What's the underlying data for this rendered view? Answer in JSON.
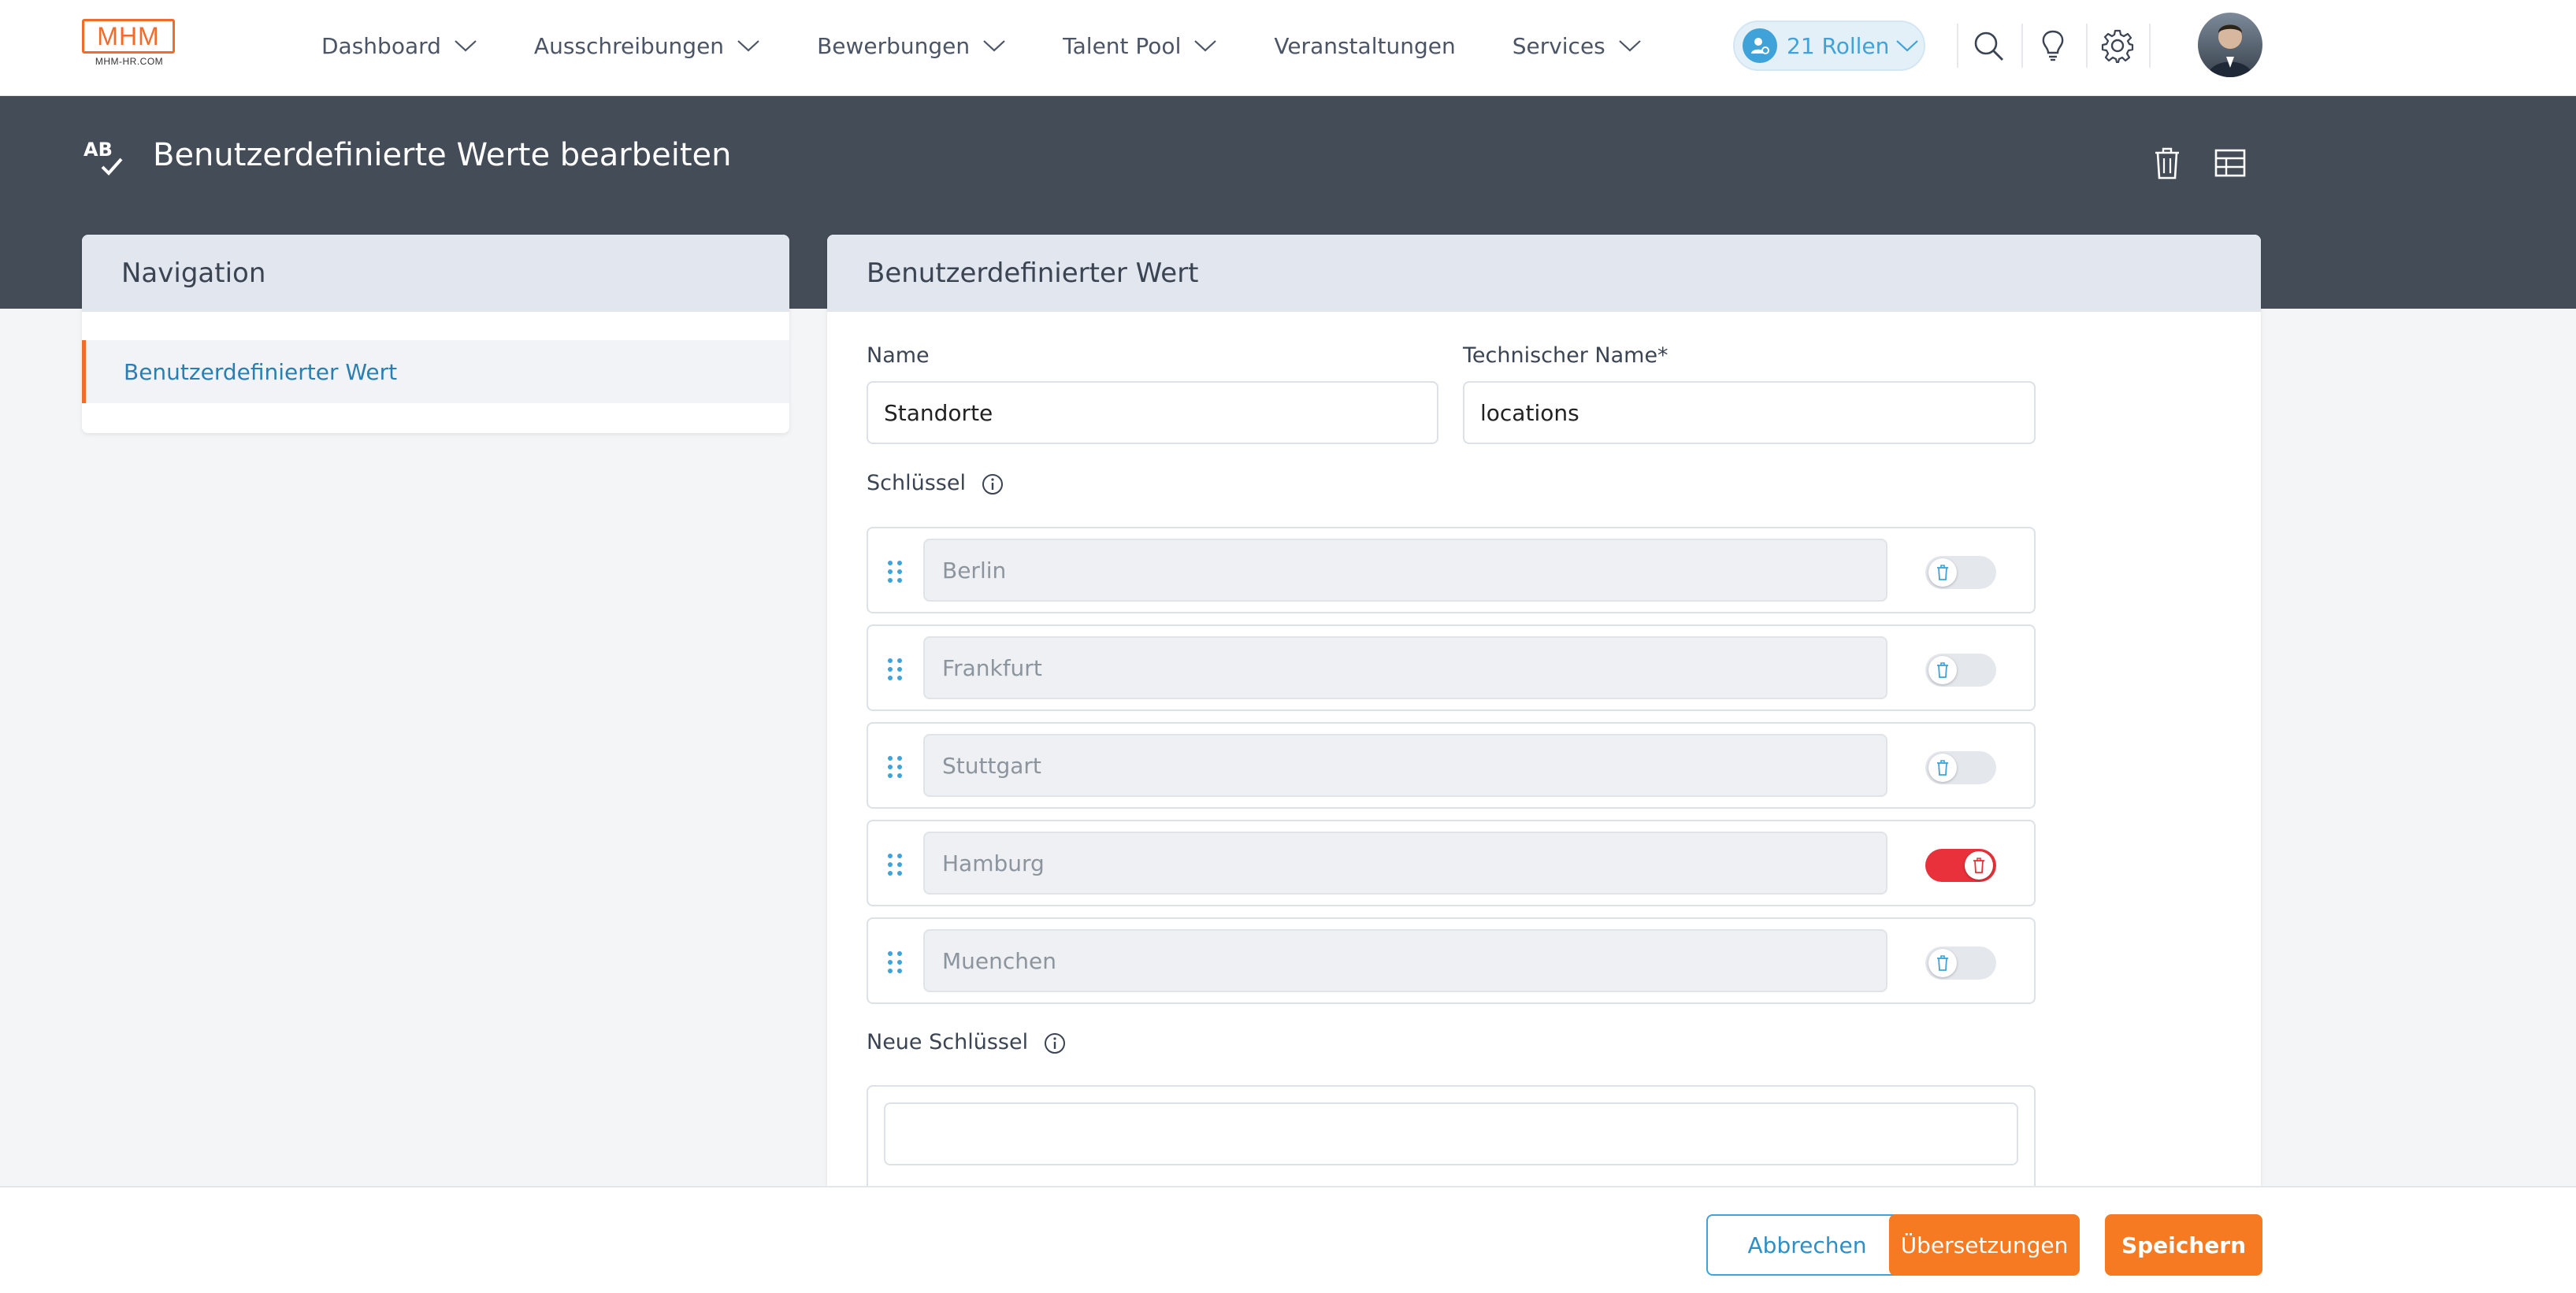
{
  "logo": {
    "brand": "MHM",
    "sub": "MHM-HR.COM"
  },
  "nav": {
    "items": [
      {
        "label": "Dashboard",
        "has_menu": true
      },
      {
        "label": "Ausschreibungen",
        "has_menu": true
      },
      {
        "label": "Bewerbungen",
        "has_menu": true
      },
      {
        "label": "Talent Pool",
        "has_menu": true
      },
      {
        "label": "Veranstaltungen",
        "has_menu": false
      },
      {
        "label": "Services",
        "has_menu": true
      }
    ],
    "roles_label": "21 Rollen"
  },
  "header": {
    "title": "Benutzerdefinierte Werte bearbeiten"
  },
  "sidebar": {
    "title": "Navigation",
    "items": [
      {
        "label": "Benutzerdefinierter Wert",
        "active": true
      }
    ]
  },
  "form": {
    "title": "Benutzerdefinierter Wert",
    "name_label": "Name",
    "name_value": "Standorte",
    "tech_label": "Technischer Name*",
    "tech_value": "locations",
    "keys_label": "Schlüssel",
    "keys": [
      {
        "value": "Berlin",
        "delete_on": false
      },
      {
        "value": "Frankfurt",
        "delete_on": false
      },
      {
        "value": "Stuttgart",
        "delete_on": false
      },
      {
        "value": "Hamburg",
        "delete_on": true
      },
      {
        "value": "Muenchen",
        "delete_on": false
      }
    ],
    "new_keys_label": "Neue Schlüssel",
    "new_key_value": ""
  },
  "footer": {
    "cancel_label": "Abbrechen",
    "translations_label": "Übersetzungen",
    "save_label": "Speichern"
  },
  "colors": {
    "accent_orange": "#f57a22",
    "accent_blue": "#3fa2d8",
    "header_band": "#444c57",
    "toggle_on": "#e8313a"
  }
}
